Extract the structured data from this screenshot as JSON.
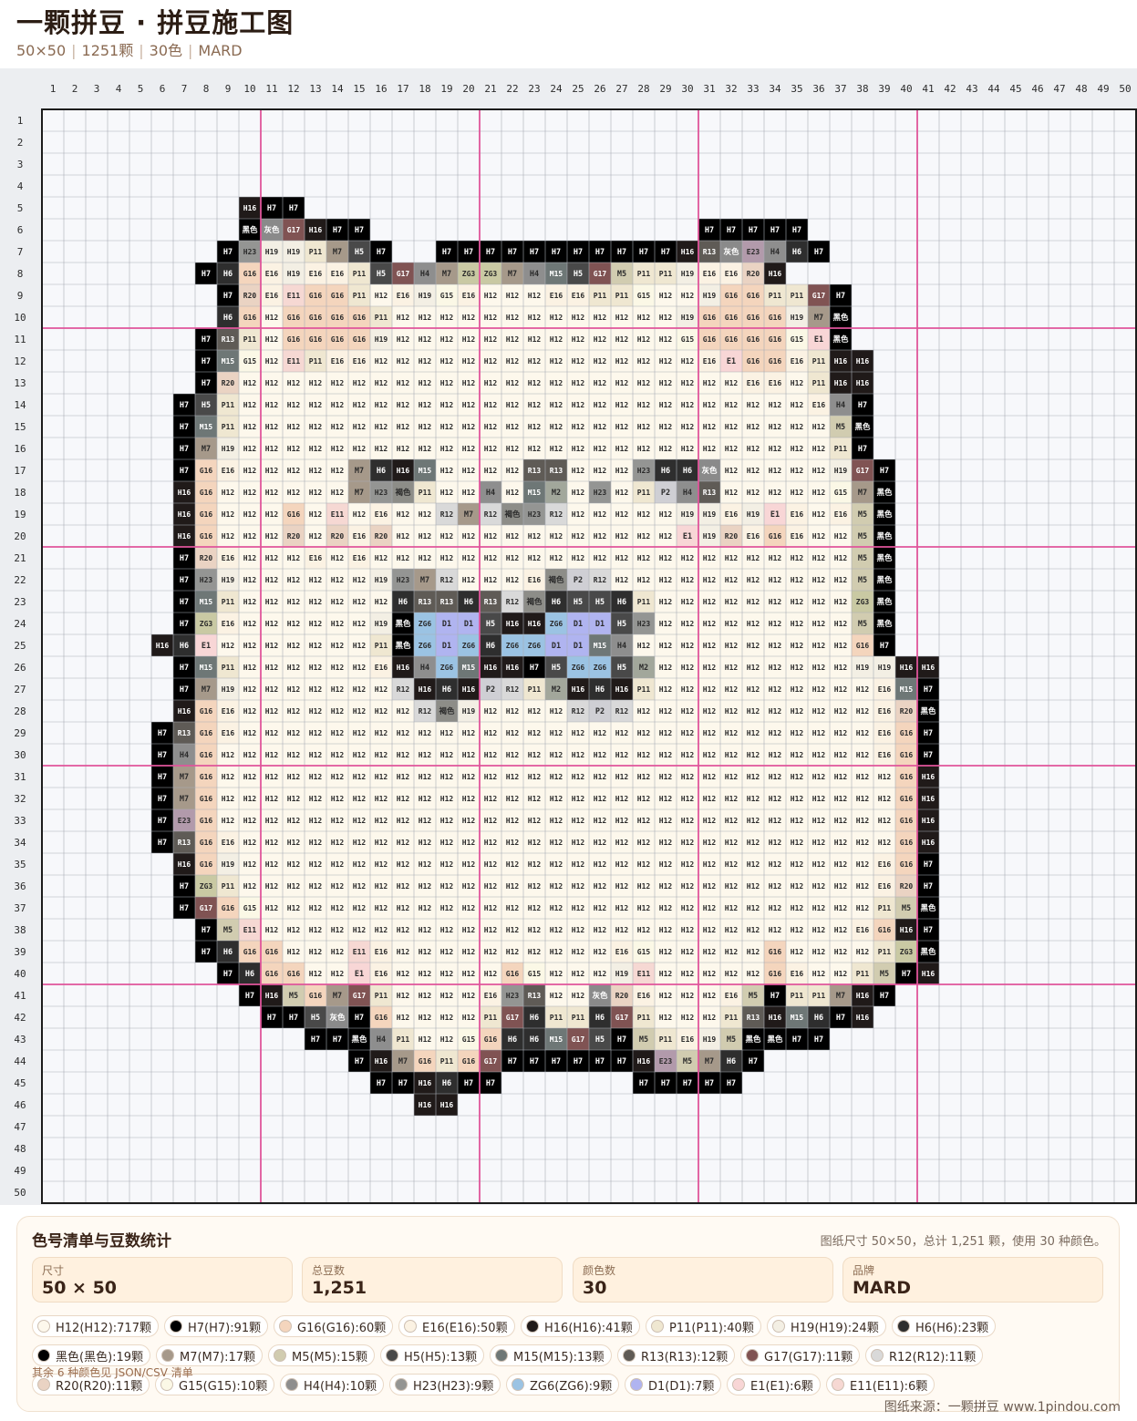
{
  "header": {
    "title": "一颗拼豆 · 拼豆施工图",
    "subtitle_parts": [
      "50×50",
      "1251颗",
      "30色",
      "MARD"
    ]
  },
  "grid": {
    "cols": 50,
    "rows": 50,
    "colors": {
      "H12": "#fdf8ec",
      "H7": "#000000",
      "G16": "#f4d5bd",
      "E16": "#fbf2e3",
      "H16": "#201a19",
      "P11": "#efe7d1",
      "H19": "#f3efe4",
      "H6": "#2e2e2e",
      "黑色": "#000000",
      "M7": "#a6998a",
      "M5": "#d1ccb0",
      "H5": "#494949",
      "M15": "#6e7776",
      "R13": "#5f5b56",
      "G17": "#805353",
      "R12": "#d9d9d9",
      "R20": "#ead3c3",
      "G15": "#fbf8e6",
      "H4": "#8e8e8e",
      "H23": "#949593",
      "ZG6": "#9bc3e3",
      "D1": "#b0b4f0",
      "E1": "#f8d6d6",
      "E11": "#f6d8d3",
      "ZG3": "#c9c9a3",
      "灰色": "#8a8a8a",
      "E23": "#b29aab",
      "M2": "#a2a79b",
      "P2": "#cfcfd4",
      "褐色": "#8d8d88"
    },
    "rows_data": [
      "",
      "",
      "",
      "",
      "10:H16,H7,H7",
      "10:黑色,灰色,G17,H16,H7,H7|31:H7,H7,H7,H7,H7",
      "9:H7,H23,H19,H19,P11,M7,H5,H7|19:H7,H7,H7,H7,H7,H7,H7,H7,H7,H7,H7,H16,R13,灰色,E23,H4,H6,H7",
      "8:H7,H6,G16,E16,H19,E16,E16,P11,H5,G17,H4,M7,ZG3,ZG3,M7,H4,M15,H5,G17,M5,P11,P11,H19,E16,E16,R20,H16",
      "9:H7,R20,E16,E11,G16,G16,P11,H12,E16,H19,G15,E16,H12,H12,H12,E16,E16,P11,P11,G15,H12,H12,H19,G16,G16,P11,P11,G17,H7",
      "9:H6,G16,H12,G16,G16,G16,G16,P11,H12,H12,H12,H12,H12,H12,H12,H12,H12,H12,H12,H12,H12,H19,G16,G16,G16,G16,H19,M7,黑色",
      "8:H7,R13,P11,H12,G16,G16,G16,G16,H19,H12,H12,H12,H12,H12,H12,H12,H12,H12,H12,H12,H12,H12,G15,G16,G16,G16,G16,G15,E1,黑色",
      "8:H7,M15,G15,H12,E11,P11,E16,E16,H12,H12,H12,H12,H12,H12,H12,H12,H12,H12,H12,H12,H12,H12,H12,E16,E1,G16,G16,E16,P11,H16,H16",
      "8:H7,R20,H12,H12,H12,H12,H12,H12,H12,H12,H12,H12,H12,H12,H12,H12,H12,H12,H12,H12,H12,H12,H12,H12,H12,E16,E16,H12,P11,H16,H16",
      "7:H7,H5,P11,H12,H12,H12,H12,H12,H12,H12,H12,H12,H12,H12,H12,H12,H12,H12,H12,H12,H12,H12,H12,H12,H12,H12,H12,H12,H12,E16,H4,H7",
      "7:H7,M15,P11,H12,H12,H12,H12,H12,H12,H12,H12,H12,H12,H12,H12,H12,H12,H12,H12,H12,H12,H12,H12,H12,H12,H12,H12,H12,H12,H12,M5,黑色",
      "7:H7,M7,H19,H12,H12,H12,H12,H12,H12,H12,H12,H12,H12,H12,H12,H12,H12,H12,H12,H12,H12,H12,H12,H12,H12,H12,H12,H12,H12,H12,P11,H7",
      "7:H7,G16,E16,H12,H12,H12,H12,H12,M7,H6,H16,M15,H12,H12,H12,H12,R13,R13,H12,H12,H12,H23,H6,H6,灰色,H12,H12,H12,H12,H12,H19,G17,H7",
      "7:H16,G16,H12,H12,H12,H12,H12,H12,M7,H23,褐色,P11,H12,H12,H4,H12,M15,M2,H12,H23,H12,P11,P2,H4,R13,H12,H12,H12,H12,H12,G15,M7,黑色",
      "7:H16,G16,H12,H12,H12,G16,H12,E11,H12,E16,H12,H12,R12,M7,R12,褐色,H23,R12,H12,H12,H12,H12,H12,H19,H19,E16,H19,E1,E16,H12,E16,M5,黑色",
      "7:H16,G16,H12,H12,H12,R20,H12,R20,E16,R20,H12,H12,H12,H12,H12,H12,H12,H12,H12,H12,H12,H12,H12,E1,H19,R20,E16,G16,E16,H12,H12,M5,黑色",
      "7:H7,R20,E16,H12,H12,H12,E16,H12,E16,H12,H12,H12,H12,H12,H12,H12,H12,H12,H12,H12,H12,H12,H12,H12,H12,H12,H12,H12,H12,H12,H12,M5,黑色",
      "7:H7,H23,H19,H12,H12,H12,H12,H12,H12,H19,H23,M7,R12,H12,H12,H12,E16,褐色,P2,R12,H12,H12,H12,H12,H12,H12,H12,H12,H12,H12,H12,M5,黑色",
      "7:H7,M15,P11,H12,H12,H12,H12,H12,H12,H12,H6,R13,R13,H6,R13,R12,褐色,H6,H5,H5,H6,P11,H12,H12,H12,H12,H12,H12,H12,H12,H12,ZG3,黑色",
      "7:H7,ZG3,E16,H12,H12,H12,H12,H12,H12,H19,黑色,ZG6,D1,D1,H5,H16,H16,ZG6,D1,D1,H5,H23,H12,H12,H12,H12,H12,H12,H12,H12,H12,M5,黑色",
      "6:H16,H6,E1,H12,H12,H12,H12,H12,H12,H12,P11,黑色,ZG6,D1,ZG6,H6,ZG6,ZG6,D1,D1,M15,H4,H12,H12,H12,H12,H12,H12,H12,H12,H12,H12,G16,H7",
      "7:H7,M15,P11,H12,H12,H12,H12,H12,H12,E16,H16,H4,ZG6,M15,H16,H16,H7,H5,ZG6,ZG6,H5,M2,H12,H12,H12,H12,H12,H12,H12,H12,H12,H19,H19,H16,H16",
      "7:H7,M7,H19,H12,H12,H12,H12,H12,H12,H12,R12,H16,H6,H16,P2,R12,P11,M2,H16,H6,H16,P11,H12,H12,H12,H12,H12,H12,H12,H12,H12,H12,E16,M15,H7",
      "7:H16,G16,E16,H12,H12,H12,H12,H12,H12,H12,H12,R12,褐色,H19,H12,H12,H12,H12,R12,P2,R12,H12,H12,H12,H12,H12,H12,H12,H12,H12,H12,H12,E16,R20,黑色",
      "6:H7,R13,G16,E16,H12,H12,H12,H12,H12,H12,H12,H12,H12,H12,H12,H12,H12,H12,H12,H12,H12,H12,H12,H12,H12,H12,H12,H12,H12,H12,H12,H12,H12,E16,G16,H7",
      "6:H7,H4,G16,H12,H12,H12,H12,H12,H12,H12,H12,H12,H12,H12,H12,H12,H12,H12,H12,H12,H12,H12,H12,H12,H12,H12,H12,H12,H12,H12,H12,H12,H12,E16,G16,H7",
      "6:H7,M7,G16,H12,H12,H12,H12,H12,H12,H12,H12,H12,H12,H12,H12,H12,H12,H12,H12,H12,H12,H12,H12,H12,H12,H12,H12,H12,H12,H12,H12,H12,H12,H12,G16,H16",
      "6:H7,M7,G16,H12,H12,H12,H12,H12,H12,H12,H12,H12,H12,H12,H12,H12,H12,H12,H12,H12,H12,H12,H12,H12,H12,H12,H12,H12,H12,H12,H12,H12,H12,H12,G16,H16",
      "6:H7,E23,G16,H12,H12,H12,H12,H12,H12,H12,H12,H12,H12,H12,H12,H12,H12,H12,H12,H12,H12,H12,H12,H12,H12,H12,H12,H12,H12,H12,H12,H12,H12,H12,G16,H16",
      "6:H7,R13,G16,E16,H12,H12,H12,H12,H12,H12,H12,H12,H12,H12,H12,H12,H12,H12,H12,H12,H12,H12,H12,H12,H12,H12,H12,H12,H12,H12,H12,H12,H12,H12,G16,H16",
      "7:H16,G16,H19,H12,H12,H12,H12,H12,H12,H12,H12,H12,H12,H12,H12,H12,H12,H12,H12,H12,H12,H12,H12,H12,H12,H12,H12,H12,H12,H12,H12,H12,E16,G16,H7",
      "7:H7,ZG3,P11,H12,H12,H12,H12,H12,H12,H12,H12,H12,H12,H12,H12,H12,H12,H12,H12,H12,H12,H12,H12,H12,H12,H12,H12,H12,H12,H12,H12,H12,E16,R20,H7",
      "7:H7,G17,G16,G15,H12,H12,H12,H12,H12,H12,H12,H12,H12,H12,H12,H12,H12,H12,H12,H12,H12,H12,H12,H12,H12,H12,H12,H12,H12,H12,H12,H12,P11,M5,黑色",
      "8:H7,M5,E11,H12,H12,H12,H12,H12,H12,H12,H12,H12,H12,H12,H12,H12,H12,H12,H12,H12,H12,H12,H12,H12,H12,H12,H12,H12,H12,H12,E16,G16,H16,H7",
      "8:H7,H6,G16,G16,H12,H12,H12,E11,E16,H12,H12,H12,H12,H12,H12,H12,H12,H12,H12,E16,G15,H12,H12,H12,H12,H12,G16,H12,H12,H12,H12,P11,ZG3,黑色",
      "9:H7,H6,G16,G16,H12,H12,E1,E16,H12,H12,H12,H12,H12,G16,G15,H12,H12,H12,H19,E11,H12,H12,H12,H12,H12,G16,E16,H12,H12,P11,M5,H7,H16",
      "10:H7,H16,M5,G16,M7,G17,P11,H12,H12,H12,H12,E16,H23,R13,H12,H12,灰色,R20,E16,H12,H12,H12,E16,M5,H7,P11,P11,M7,H16,H7",
      "11:H7,H7,H5,灰色,H7,G16,H12,H12,H12,H12,P11,G17,H6,P11,P11,H6,G17,P11,H12,H12,H12,P11,R13,H16,M15,H6,H7,H16",
      "13:H7,H7,黑色,H4,P11,H12,H12,G15,G16,H6,H6,M15,G17,H5,H7,M5,P11,E16,H19,M5,黑色,黑色,H7,H7",
      "15:H7,H16,M7,G16,P11,G16,G17,H7,H7,H7,H7,H7,H7,H16,E23,M5,M7,H6,H7",
      "16:H7,H7,H16,H6,H7,H7|28:H7,H7,H7,H7,H7",
      "18:H16,H16",
      "",
      "",
      "",
      ""
    ]
  },
  "stats": {
    "title": "色号清单与豆数统计",
    "note": "图纸尺寸 50×50，总计 1,251 颗，使用 30 种颜色。",
    "boxes": [
      {
        "label": "尺寸",
        "value": "50 × 50"
      },
      {
        "label": "总豆数",
        "value": "1,251"
      },
      {
        "label": "颜色数",
        "value": "30"
      },
      {
        "label": "品牌",
        "value": "MARD"
      }
    ],
    "chips": [
      {
        "text": "H12(H12):717颗",
        "color": "#fdf8ec"
      },
      {
        "text": "H7(H7):91颗",
        "color": "#000000"
      },
      {
        "text": "G16(G16):60颗",
        "color": "#f4d5bd"
      },
      {
        "text": "E16(E16):50颗",
        "color": "#fbf2e3"
      },
      {
        "text": "H16(H16):41颗",
        "color": "#201a19"
      },
      {
        "text": "P11(P11):40颗",
        "color": "#efe7d1"
      },
      {
        "text": "H19(H19):24颗",
        "color": "#f3efe4"
      },
      {
        "text": "H6(H6):23颗",
        "color": "#2e2e2e"
      },
      {
        "text": "黑色(黑色):19颗",
        "color": "#000000"
      },
      {
        "text": "M7(M7):17颗",
        "color": "#a6998a"
      },
      {
        "text": "M5(M5):15颗",
        "color": "#d1ccb0"
      },
      {
        "text": "H5(H5):13颗",
        "color": "#494949"
      },
      {
        "text": "M15(M15):13颗",
        "color": "#6e7776"
      },
      {
        "text": "R13(R13):12颗",
        "color": "#5f5b56"
      },
      {
        "text": "G17(G17):11颗",
        "color": "#805353"
      },
      {
        "text": "R12(R12):11颗",
        "color": "#d9d9d9"
      },
      {
        "text": "R20(R20):11颗",
        "color": "#ead3c3"
      },
      {
        "text": "G15(G15):10颗",
        "color": "#fbf8e6"
      },
      {
        "text": "H4(H4):10颗",
        "color": "#8e8e8e"
      },
      {
        "text": "H23(H23):9颗",
        "color": "#949593"
      },
      {
        "text": "ZG6(ZG6):9颗",
        "color": "#9bc3e3"
      },
      {
        "text": "D1(D1):7颗",
        "color": "#b0b4f0"
      },
      {
        "text": "E1(E1):6颗",
        "color": "#f8d6d6"
      },
      {
        "text": "E11(E11):6颗",
        "color": "#f6d8d3"
      }
    ],
    "more": "其余 6 种颜色见 JSON/CSV 清单"
  },
  "footer": {
    "text": "图纸来源：一颗拼豆 www.1pindou.com"
  }
}
